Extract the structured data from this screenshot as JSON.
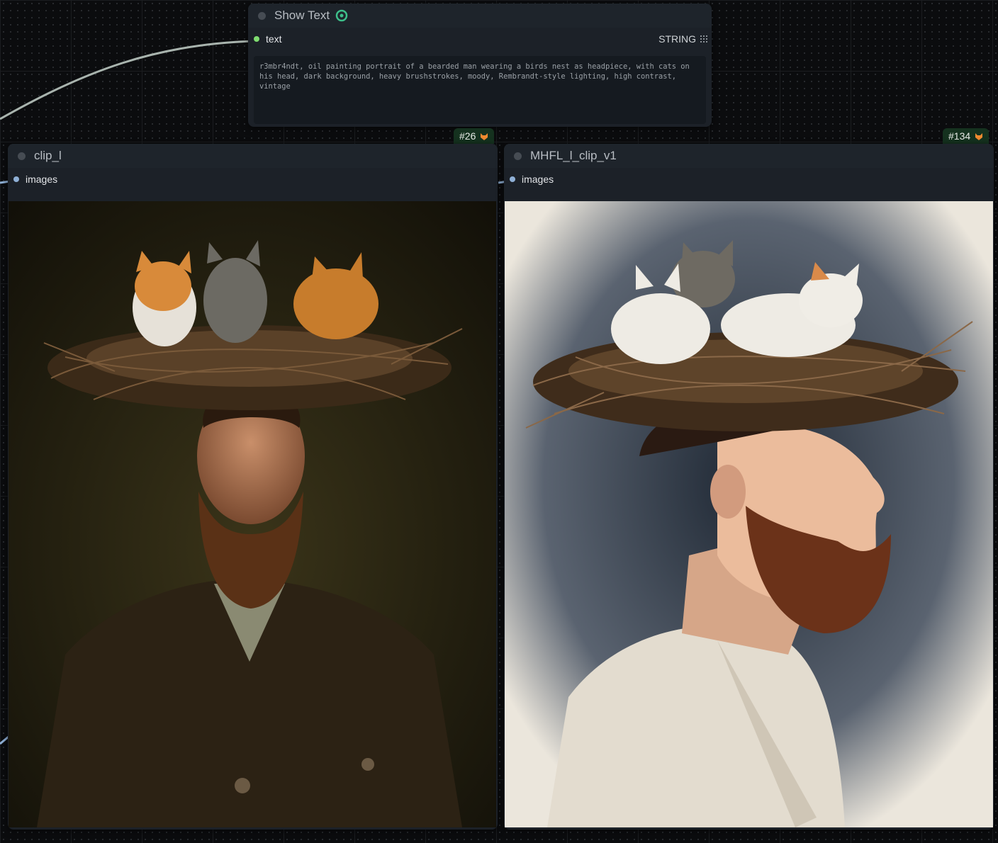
{
  "nodes": {
    "show_text": {
      "title": "Show Text",
      "input_label": "text",
      "output_type": "STRING",
      "text_value": "r3mbr4ndt, oil painting portrait of a bearded man wearing a birds nest as headpiece, with cats on his head, dark background, heavy brushstrokes, moody, Rembrandt-style lighting, high contrast, vintage"
    },
    "left": {
      "badge": "#26",
      "title": "clip_l",
      "input_label": "images"
    },
    "right": {
      "badge": "#134",
      "title": "MHFL_l_clip_v1",
      "input_label": "images"
    }
  },
  "icons": {
    "show_text_node_icon": "link-icon",
    "badge_icon": "fox-icon",
    "output_type_icon": "grid-icon"
  },
  "colors": {
    "canvas": "#0b0c0e",
    "node_bg": "#1c2128",
    "text_slot": "#7fdc70",
    "image_slot": "#8fb0d6",
    "badge_bg": "#15321f",
    "badge_icon": "#f08a30"
  }
}
